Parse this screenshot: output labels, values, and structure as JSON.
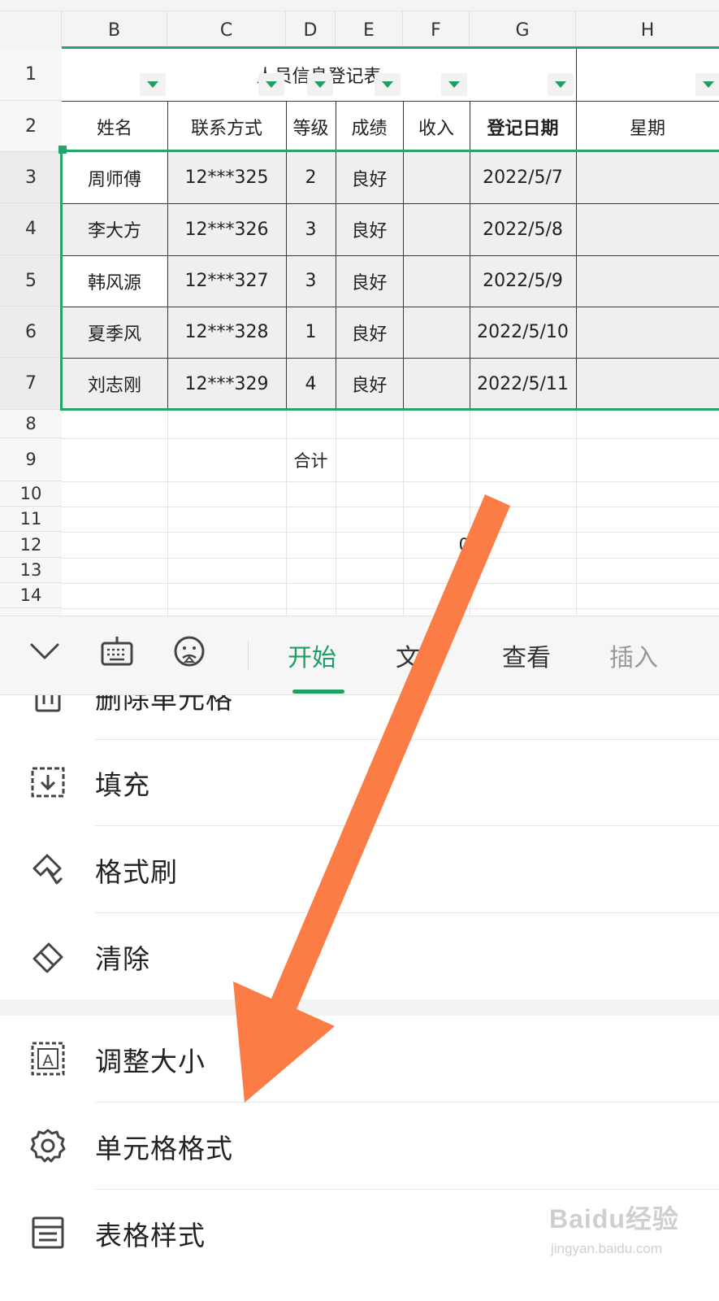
{
  "sheet": {
    "columns": [
      "B",
      "C",
      "D",
      "E",
      "F",
      "G",
      "H"
    ],
    "rows": [
      "1",
      "2",
      "3",
      "4",
      "5",
      "6",
      "7",
      "8",
      "9",
      "10",
      "11",
      "12",
      "13",
      "14"
    ],
    "title": "人员信息登记表",
    "headers": [
      "姓名",
      "联系方式",
      "等级",
      "成绩",
      "收入",
      "登记日期",
      "星期"
    ],
    "records": [
      {
        "name": "周师傅",
        "contact": "12***325",
        "level": "2",
        "score": "良好",
        "income": "",
        "date": "2022/5/7",
        "weekday": ""
      },
      {
        "name": "李大方",
        "contact": "12***326",
        "level": "3",
        "score": "良好",
        "income": "",
        "date": "2022/5/8",
        "weekday": ""
      },
      {
        "name": "韩风源",
        "contact": "12***327",
        "level": "3",
        "score": "良好",
        "income": "",
        "date": "2022/5/9",
        "weekday": ""
      },
      {
        "name": "夏季风",
        "contact": "12***328",
        "level": "1",
        "score": "良好",
        "income": "",
        "date": "2022/5/10",
        "weekday": ""
      },
      {
        "name": "刘志刚",
        "contact": "12***329",
        "level": "4",
        "score": "良好",
        "income": "",
        "date": "2022/5/11",
        "weekday": ""
      }
    ],
    "total_label": "合计",
    "total_value": "0",
    "accent_color": "#27a46a"
  },
  "toolbar": {
    "icons": [
      "collapse-chevron-icon",
      "keyboard-icon",
      "emoji-icon"
    ],
    "tabs": [
      "开始",
      "文件",
      "查看",
      "插入"
    ],
    "active_tab": "开始",
    "active_color": "#1f9d62"
  },
  "menu": {
    "partial_item": "删除单元格",
    "group1": [
      {
        "icon": "fill-icon",
        "label": "填充"
      },
      {
        "icon": "format-painter-icon",
        "label": "格式刷"
      },
      {
        "icon": "eraser-icon",
        "label": "清除"
      }
    ],
    "group2": [
      {
        "icon": "resize-icon",
        "label": "调整大小"
      },
      {
        "icon": "gear-icon",
        "label": "单元格格式"
      },
      {
        "icon": "table-style-icon",
        "label": "表格样式"
      }
    ]
  },
  "annotation": {
    "arrow_color": "#fb7d45"
  },
  "watermark": {
    "main": "Baidu经验",
    "sub": "jingyan.baidu.com"
  }
}
